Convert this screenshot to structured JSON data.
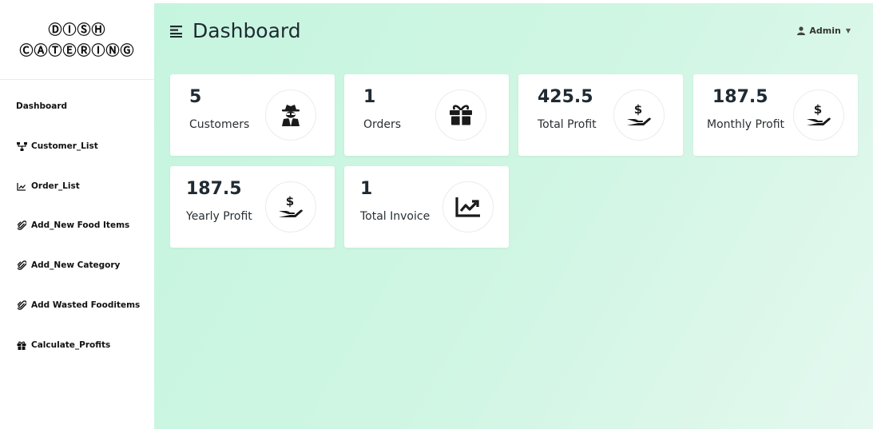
{
  "brand": {
    "line1": "ⒹⒾⓈⒽ",
    "line2": "ⒸⒶⓉⒺⓇⒾⓃⒼ"
  },
  "sidebar": {
    "items": [
      {
        "label": "Dashboard",
        "icon": "none"
      },
      {
        "label": "Customer_List",
        "icon": "sitemap-icon"
      },
      {
        "label": "Order_List",
        "icon": "line-chart-icon"
      },
      {
        "label": "Add_New Food Items",
        "icon": "paperclip-icon"
      },
      {
        "label": "Add_New Category",
        "icon": "paperclip-icon"
      },
      {
        "label": "Add Wasted Fooditems",
        "icon": "paperclip-icon"
      },
      {
        "label": "Calculate_Profits",
        "icon": "gift-icon"
      }
    ]
  },
  "header": {
    "title": "Dashboard",
    "user": "Admin"
  },
  "cards": [
    {
      "value": "5",
      "label": "Customers",
      "icon": "user-secret-icon"
    },
    {
      "value": "1",
      "label": "Orders",
      "icon": "gift-icon"
    },
    {
      "value": "425.5",
      "label": "Total Profit",
      "icon": "hand-holding-dollar-icon"
    },
    {
      "value": "187.5",
      "label": "Monthly Profit",
      "icon": "hand-holding-dollar-icon"
    },
    {
      "value": "187.5",
      "label": "Yearly Profit",
      "icon": "hand-holding-dollar-icon"
    },
    {
      "value": "1",
      "label": "Total Invoice",
      "icon": "line-chart-icon"
    }
  ],
  "colors": {
    "main_bg_start": "#c6f5df",
    "main_bg_end": "#e4f8ef",
    "card_bg": "#ffffff",
    "text": "#1f2a33"
  }
}
